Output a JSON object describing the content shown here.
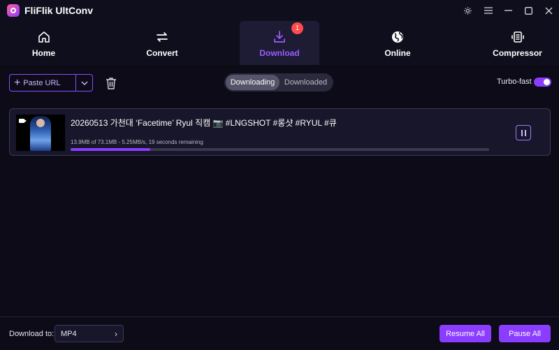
{
  "app": {
    "title": "FliFlik UltConv"
  },
  "window_controls": [
    {
      "name": "settings-icon",
      "glyph": "⚙"
    },
    {
      "name": "menu-icon",
      "glyph": "☰"
    },
    {
      "name": "minimize-icon",
      "glyph": "—"
    },
    {
      "name": "maximize-icon",
      "glyph": "☐"
    },
    {
      "name": "close-icon",
      "glyph": "✕"
    }
  ],
  "nav": {
    "tabs": [
      {
        "label": "Home",
        "icon": "home-icon"
      },
      {
        "label": "Convert",
        "icon": "convert-icon"
      },
      {
        "label": "Download",
        "icon": "download-icon",
        "active": true,
        "badge": "1"
      },
      {
        "label": "Online",
        "icon": "globe-icon"
      },
      {
        "label": "Compressor",
        "icon": "compress-icon"
      }
    ]
  },
  "toolbar": {
    "paste_label": "Paste URL",
    "segment": {
      "downloading": "Downloading",
      "downloaded": "Downloaded"
    },
    "turbo_label": "Turbo-fast",
    "turbo_on": true
  },
  "downloads": [
    {
      "title": "20260513 가천대 ‘Facetime’ Ryul 직캠 📷 #LNGSHOT #롱샷 #RYUL #큐",
      "info": "13.9MB of 73.1MB -   5.25MB/s, 19 seconds remaining",
      "progress": 0.19
    }
  ],
  "footer": {
    "download_to_label": "Download to:",
    "format": "MP4",
    "resume_all": "Resume All",
    "pause_all": "Pause All"
  },
  "colors": {
    "accent": "#8b3dff",
    "background": "#0c0b17",
    "badge": "#ff4b4b"
  }
}
